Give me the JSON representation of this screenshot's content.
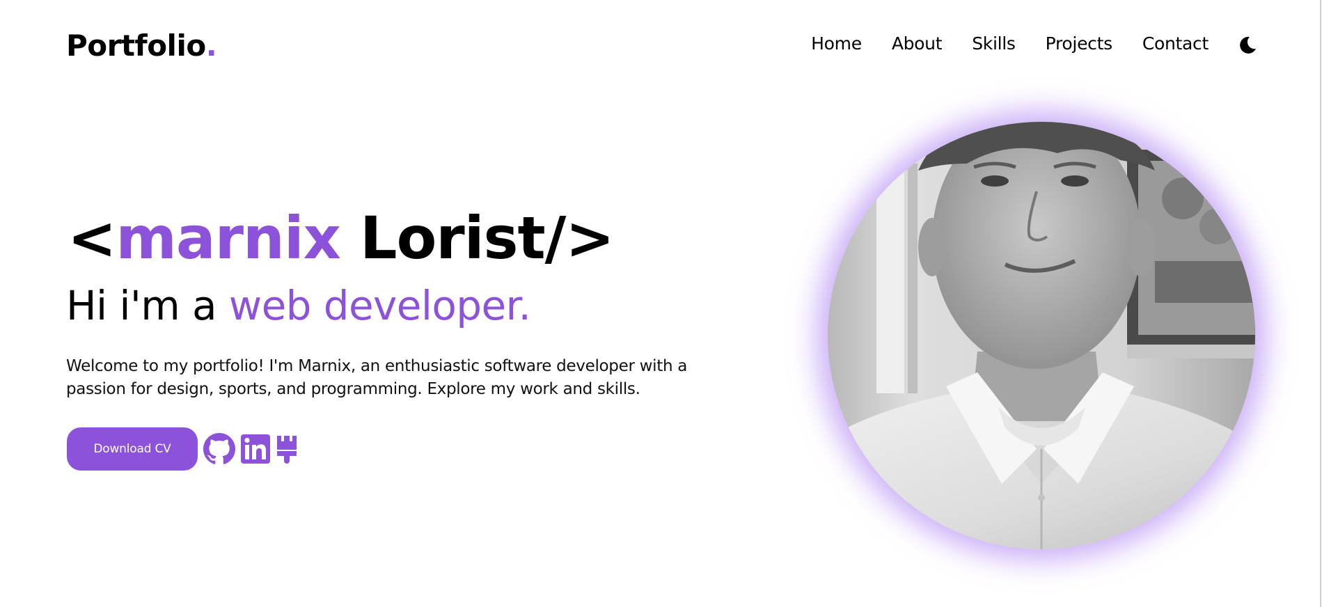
{
  "header": {
    "logo_text": "Portfolio",
    "logo_dot": ".",
    "nav": [
      {
        "label": "Home"
      },
      {
        "label": "About"
      },
      {
        "label": "Skills"
      },
      {
        "label": "Projects"
      },
      {
        "label": "Contact"
      }
    ],
    "theme_toggle_icon": "moon-icon"
  },
  "hero": {
    "title_open": "<",
    "title_first": "marnix",
    "title_rest": " Lorist/>",
    "subtitle_prefix": "Hi i'm a ",
    "subtitle_highlight": "web developer.",
    "description": "Welcome to my portfolio! I'm Marnix, an enthusiastic software developer with a passion for design, sports, and programming. Explore my work and skills.",
    "download_label": "Download CV",
    "social_icons": [
      "github-icon",
      "linkedin-icon",
      "paintbrush-icon"
    ],
    "portrait": "grayscale photo of a young man in a white shirt"
  },
  "colors": {
    "accent": "#8c52d9",
    "text": "#000000",
    "background": "#ffffff"
  }
}
